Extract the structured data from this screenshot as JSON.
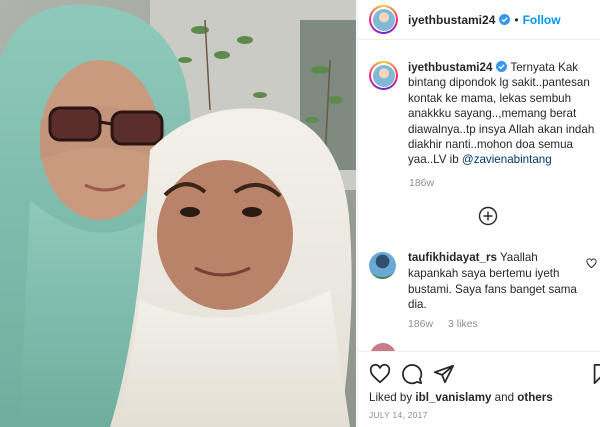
{
  "post": {
    "username": "iyethbustami24",
    "follow_label": "Follow",
    "dot_separator": "•",
    "caption": {
      "username": "iyethbustami24",
      "text": "Ternyata Kak bintang dipondok lg sakit..pantesan kontak ke mama, lekas sembuh anakkku sayang..,memang berat diawalnya..tp insya Allah akan indah diakhir nanti..mohon doa semua yaa..LV ib ",
      "mention": "@zavienabintang",
      "time": "186w"
    },
    "comment": {
      "username": "taufikhidayat_rs",
      "text": "Yaallah kapankah saya bertemu iyeth bustami. Saya fans banget sama dia.",
      "time": "186w",
      "likes": "3 likes"
    },
    "liked_by": {
      "prefix": "Liked by ",
      "user": "ibl_vanislamy",
      "connector": " and ",
      "others": "others"
    },
    "date": "JULY 14, 2017"
  },
  "icons": {
    "verified": "verified-badge-icon",
    "load_more": "plus-circle-icon",
    "comment_like": "heart-icon",
    "like": "heart-icon",
    "comment": "comment-bubble-icon",
    "share": "paper-plane-icon",
    "save": "bookmark-icon"
  },
  "colors": {
    "link": "#0095f6",
    "verified": "#3897f0",
    "mention": "#00376b",
    "muted": "#8e8e8e"
  }
}
